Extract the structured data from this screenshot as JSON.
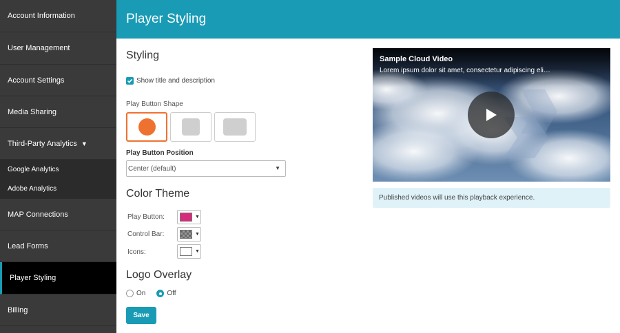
{
  "sidebar": {
    "items": [
      {
        "label": "Account Information"
      },
      {
        "label": "User Management"
      },
      {
        "label": "Account Settings"
      },
      {
        "label": "Media Sharing"
      },
      {
        "label": "Third-Party Analytics",
        "caret": "▼"
      },
      {
        "label": "Google Analytics"
      },
      {
        "label": "Adobe Analytics"
      },
      {
        "label": "MAP Connections"
      },
      {
        "label": "Lead Forms"
      },
      {
        "label": "Player Styling"
      },
      {
        "label": "Billing"
      }
    ],
    "active_item": "Player Styling"
  },
  "header": {
    "title": "Player Styling"
  },
  "styling": {
    "heading": "Styling",
    "show_title_label": "Show title and description",
    "show_title_checked": true,
    "play_button_shape_label": "Play Button Shape",
    "shapes": [
      "circle",
      "rounded-square",
      "rounded-rectangle"
    ],
    "selected_shape": "circle",
    "play_button_position_label": "Play Button Position",
    "play_button_position_value": "Center (default)"
  },
  "color_theme": {
    "heading": "Color Theme",
    "play_button_label": "Play Button:",
    "play_button_color": "#d9297b",
    "control_bar_label": "Control Bar:",
    "control_bar_color": "transparent-checker",
    "icons_label": "Icons:",
    "icons_color": "#ffffff"
  },
  "logo_overlay": {
    "heading": "Logo Overlay",
    "on_label": "On",
    "off_label": "Off",
    "selected": "Off"
  },
  "save_label": "Save",
  "preview": {
    "video_title": "Sample Cloud Video",
    "video_description": "Lorem ipsum dolor sit amet, consectetur adipiscing eli…",
    "notice": "Published videos will use this playback experience."
  },
  "colors": {
    "accent": "#1a9bb5",
    "sidebar_bg": "#3a3a3a",
    "selected_shape_border": "#ef7130",
    "play_shape_fill": "#ef7130",
    "notice_bg": "#dff2f8"
  }
}
